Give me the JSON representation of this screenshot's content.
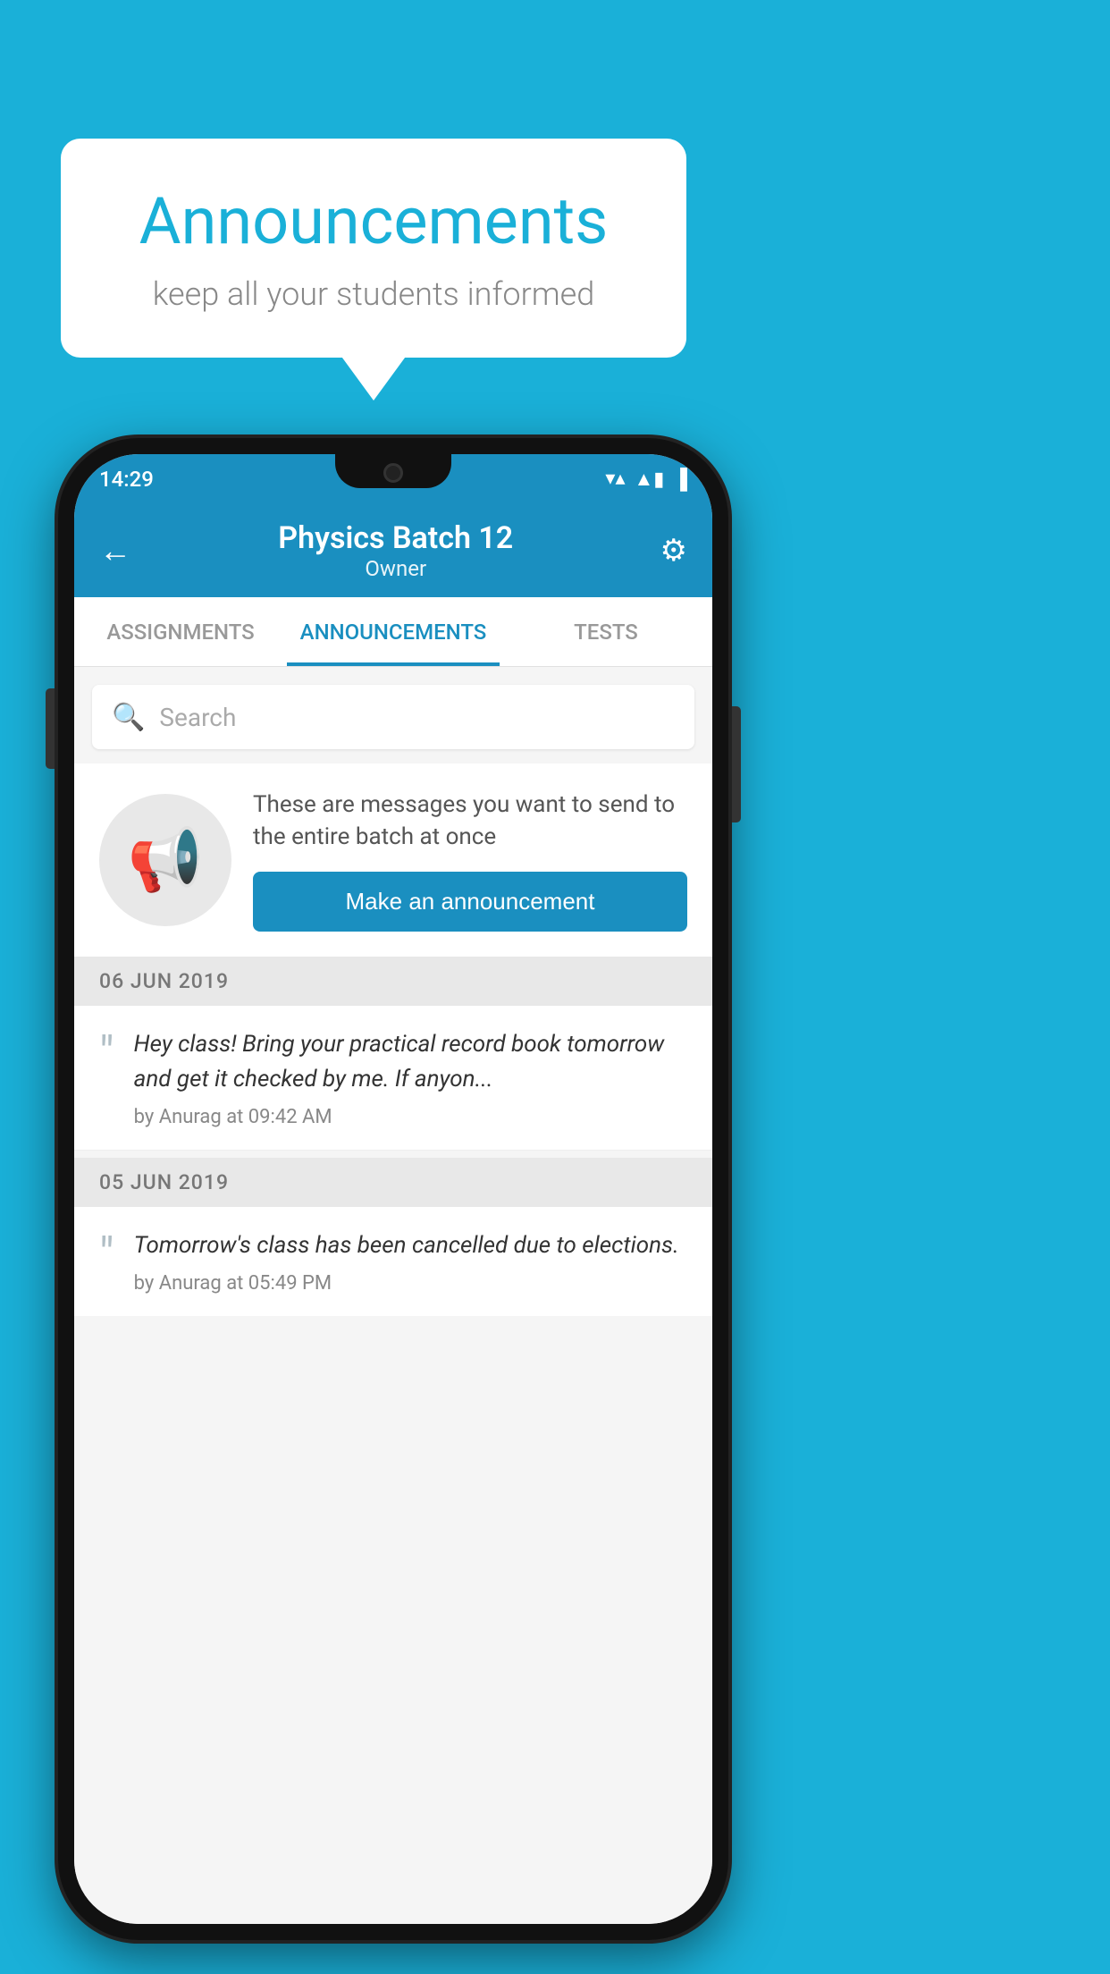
{
  "background_color": "#1ab0d8",
  "speech_bubble": {
    "title": "Announcements",
    "subtitle": "keep all your students informed"
  },
  "phone": {
    "status_bar": {
      "time": "14:29",
      "wifi": "▼",
      "signal": "▲",
      "battery": "█"
    },
    "header": {
      "title": "Physics Batch 12",
      "subtitle": "Owner",
      "back_label": "←",
      "gear_label": "⚙"
    },
    "tabs": [
      {
        "label": "ASSIGNMENTS",
        "active": false
      },
      {
        "label": "ANNOUNCEMENTS",
        "active": true
      },
      {
        "label": "TESTS",
        "active": false
      },
      {
        "label": "...",
        "active": false
      }
    ],
    "search": {
      "placeholder": "Search"
    },
    "promo": {
      "description": "These are messages you want to send to the entire batch at once",
      "button_label": "Make an announcement"
    },
    "announcements": [
      {
        "date": "06  JUN  2019",
        "text": "Hey class! Bring your practical record book tomorrow and get it checked by me. If anyon...",
        "meta": "by Anurag at 09:42 AM"
      },
      {
        "date": "05  JUN  2019",
        "text": "Tomorrow's class has been cancelled due to elections.",
        "meta": "by Anurag at 05:49 PM"
      }
    ]
  }
}
